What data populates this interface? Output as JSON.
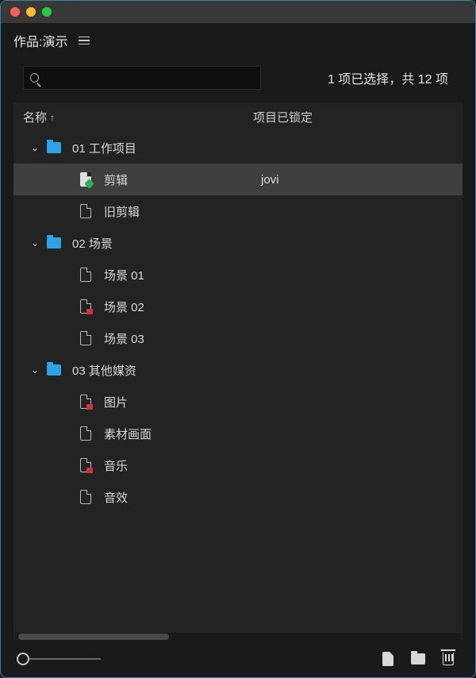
{
  "panel": {
    "title": "作品:演示"
  },
  "status": "1 项已选择，共 12 项",
  "columns": {
    "name": "名称",
    "locked": "项目已锁定"
  },
  "rows": [
    {
      "type": "folder",
      "depth": 0,
      "expanded": true,
      "chevron": true,
      "label": "01 工作项目",
      "locked_by": "",
      "selected": false,
      "icon": "folder"
    },
    {
      "type": "file",
      "depth": 1,
      "expanded": false,
      "chevron": false,
      "label": "剪辑",
      "locked_by": "jovi",
      "selected": true,
      "icon": "file-green"
    },
    {
      "type": "file",
      "depth": 1,
      "expanded": false,
      "chevron": false,
      "label": "旧剪辑",
      "locked_by": "",
      "selected": false,
      "icon": "file"
    },
    {
      "type": "folder",
      "depth": 0,
      "expanded": true,
      "chevron": true,
      "label": "02 场景",
      "locked_by": "",
      "selected": false,
      "icon": "folder"
    },
    {
      "type": "file",
      "depth": 1,
      "expanded": false,
      "chevron": false,
      "label": "场景 01",
      "locked_by": "",
      "selected": false,
      "icon": "file"
    },
    {
      "type": "file",
      "depth": 1,
      "expanded": false,
      "chevron": false,
      "label": "场景 02",
      "locked_by": "",
      "selected": false,
      "icon": "file-locked"
    },
    {
      "type": "file",
      "depth": 1,
      "expanded": false,
      "chevron": false,
      "label": "场景 03",
      "locked_by": "",
      "selected": false,
      "icon": "file"
    },
    {
      "type": "folder",
      "depth": 0,
      "expanded": true,
      "chevron": true,
      "label": "03 其他媒资",
      "locked_by": "",
      "selected": false,
      "icon": "folder"
    },
    {
      "type": "file",
      "depth": 1,
      "expanded": false,
      "chevron": false,
      "label": "图片",
      "locked_by": "",
      "selected": false,
      "icon": "file-locked"
    },
    {
      "type": "file",
      "depth": 1,
      "expanded": false,
      "chevron": false,
      "label": "素材画面",
      "locked_by": "",
      "selected": false,
      "icon": "file"
    },
    {
      "type": "file",
      "depth": 1,
      "expanded": false,
      "chevron": false,
      "label": "音乐",
      "locked_by": "",
      "selected": false,
      "icon": "file-locked"
    },
    {
      "type": "file",
      "depth": 1,
      "expanded": false,
      "chevron": false,
      "label": "音效",
      "locked_by": "",
      "selected": false,
      "icon": "file"
    }
  ]
}
